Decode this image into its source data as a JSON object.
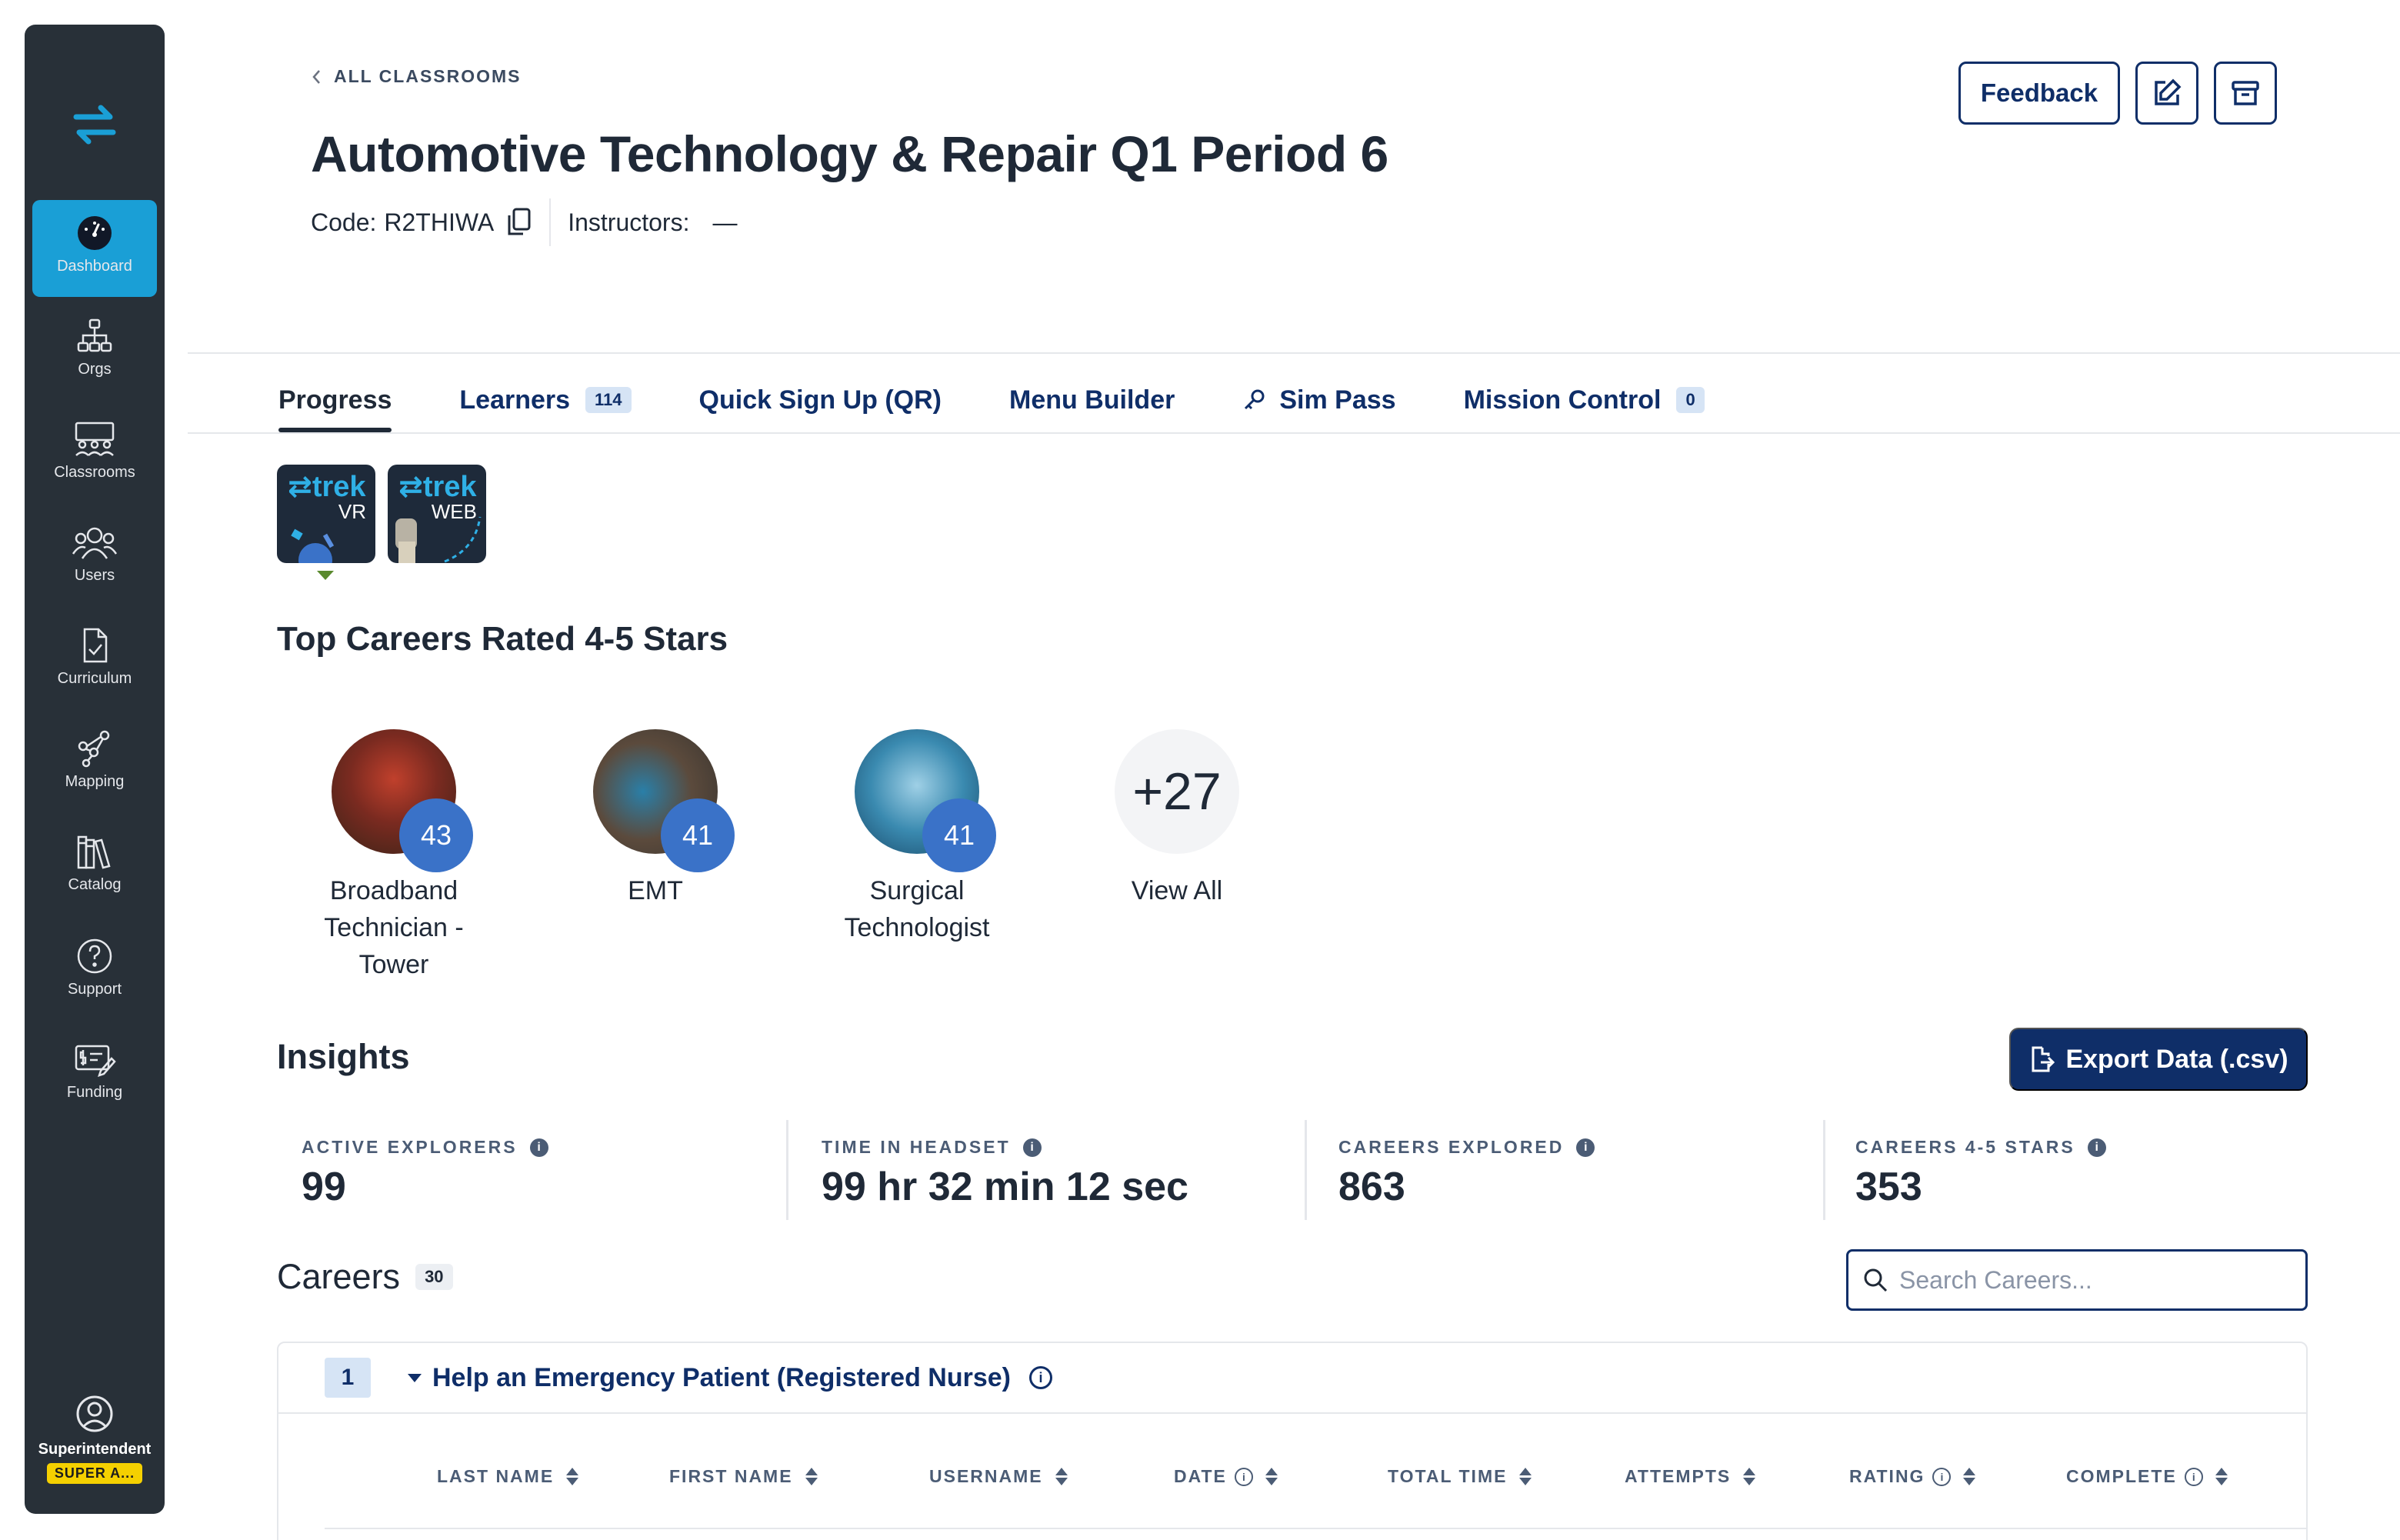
{
  "sidebar": {
    "items": [
      {
        "label": "Dashboard",
        "icon": "gauge-icon"
      },
      {
        "label": "Orgs",
        "icon": "org-chart-icon"
      },
      {
        "label": "Classrooms",
        "icon": "classroom-icon"
      },
      {
        "label": "Users",
        "icon": "users-icon"
      },
      {
        "label": "Curriculum",
        "icon": "document-check-icon"
      },
      {
        "label": "Mapping",
        "icon": "share-nodes-icon"
      },
      {
        "label": "Catalog",
        "icon": "books-icon"
      },
      {
        "label": "Support",
        "icon": "help-circle-icon"
      },
      {
        "label": "Funding",
        "icon": "funding-icon"
      }
    ],
    "user": {
      "role": "Superintendent",
      "badge": "SUPER A..."
    }
  },
  "header": {
    "breadcrumb": "ALL CLASSROOMS",
    "title": "Automotive Technology & Repair Q1 Period 6",
    "code_label": "Code:",
    "code_value": "R2THIWA",
    "instructors_label": "Instructors:",
    "instructors_value": "—",
    "feedback_label": "Feedback"
  },
  "tabs": [
    {
      "label": "Progress",
      "active": true
    },
    {
      "label": "Learners",
      "count": "114"
    },
    {
      "label": "Quick Sign Up (QR)"
    },
    {
      "label": "Menu Builder"
    },
    {
      "label": "Sim Pass"
    },
    {
      "label": "Mission Control",
      "count": "0"
    }
  ],
  "products": [
    {
      "brand": "⇄trek",
      "kind": "VR"
    },
    {
      "brand": "⇄trek",
      "kind": "WEB"
    }
  ],
  "top_careers": {
    "title": "Top Careers Rated 4-5 Stars",
    "items": [
      {
        "name_lines": [
          "Broadband",
          "Technician -",
          "Tower"
        ],
        "count": "43"
      },
      {
        "name_lines": [
          "EMT"
        ],
        "count": "41"
      },
      {
        "name_lines": [
          "Surgical",
          "Technologist"
        ],
        "count": "41"
      }
    ],
    "more": {
      "count": "+27",
      "label": "View All"
    }
  },
  "insights": {
    "title": "Insights",
    "export_label": "Export Data (.csv)",
    "stats": [
      {
        "label": "ACTIVE EXPLORERS",
        "value": "99"
      },
      {
        "label": "TIME IN HEADSET",
        "value": "99 hr 32 min 12 sec"
      },
      {
        "label": "CAREERS EXPLORED",
        "value": "863"
      },
      {
        "label": "CAREERS 4-5 STARS",
        "value": "353"
      }
    ]
  },
  "careers": {
    "title": "Careers",
    "count": "30",
    "search_placeholder": "Search Careers...",
    "group": {
      "number": "1",
      "title": "Help an Emergency Patient (Registered Nurse)",
      "columns": [
        "LAST NAME",
        "FIRST NAME",
        "USERNAME",
        "DATE",
        "TOTAL TIME",
        "ATTEMPTS",
        "RATING",
        "COMPLETE"
      ]
    }
  },
  "colors": {
    "sidebar_bg": "#283038",
    "active_nav": "#1a9fd6",
    "navy": "#0f2e68",
    "badge_blue": "#3a72c8",
    "super_badge": "#f5d000"
  }
}
